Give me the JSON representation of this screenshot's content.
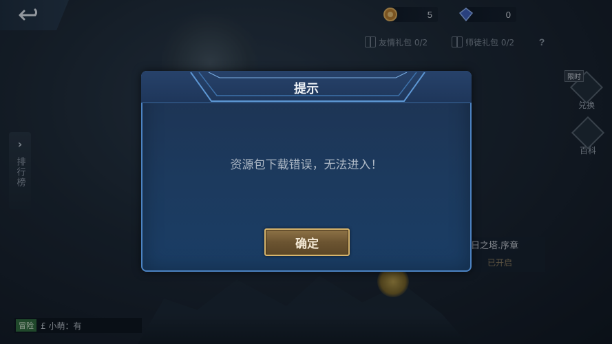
{
  "top_bar": {
    "coins": "5",
    "gems": "0"
  },
  "gifts": {
    "friend_gift": "友情礼包 0/2",
    "mentor_gift": "师徒礼包 0/2",
    "help": "?"
  },
  "side": {
    "limited_badge": "限时",
    "exchange_label": "兑换",
    "wiki_label": "百科",
    "ranking_label": "排行榜"
  },
  "event": {
    "title": "日之塔.序章",
    "status": "已开启"
  },
  "chat": {
    "channel": "冒险",
    "message": "£ 小萌：有"
  },
  "dialog": {
    "title": "提示",
    "message": "资源包下载错误，无法进入！",
    "confirm_label": "确定"
  },
  "colors": {
    "dialog_border": "#4c83c2",
    "dialog_bg": "#1c3a5e",
    "button_gold": "#d8b56c"
  }
}
